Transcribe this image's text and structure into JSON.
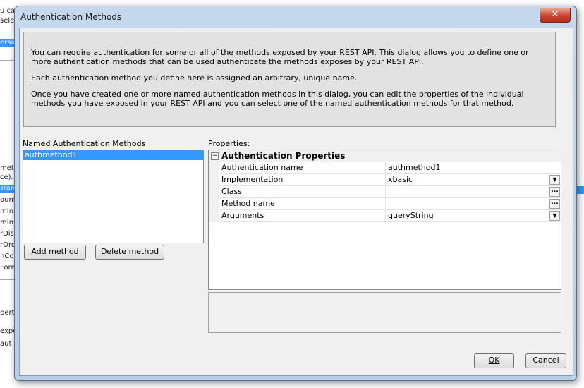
{
  "background": {
    "fragments": [
      "u can",
      "sele",
      "ersion",
      "meth",
      "ce).",
      "Tran",
      "ount",
      "mIns",
      "mIns",
      "rDisp",
      "rOrd",
      "nCom",
      "Form",
      "perti",
      "expo",
      "aut"
    ]
  },
  "dialog": {
    "title": "Authentication Methods",
    "close_glyph": "✕",
    "info": {
      "p1": "You can require authentication for some or all of the methods exposed by your REST API. This dialog allows you to define one or more authentication methods that can be used authenticate the methods exposes by your REST API.",
      "p2": "Each authentication method you define here is assigned an arbitrary, unique name.",
      "p3": "Once you have created one or more named authentication methods in this dialog, you can edit the properties of the individual methods you have exposed in your REST API and you can select one of the named authentication methods for that method."
    },
    "methods_label": "Named Authentication Methods",
    "methods": [
      "authmethod1"
    ],
    "add_button": "Add method",
    "delete_button": "Delete method",
    "properties_label": "Properties:",
    "grid": {
      "category": "Authentication Properties",
      "toggle": "−",
      "rows": [
        {
          "name": "Authentication name",
          "value": "authmethod1"
        },
        {
          "name": "Implementation",
          "value": "xbasic"
        },
        {
          "name": "Class",
          "value": ""
        },
        {
          "name": "Method name",
          "value": ""
        },
        {
          "name": "Arguments",
          "value": "queryString"
        }
      ],
      "dropdown_glyph": "▼",
      "ellipsis_glyph": "..."
    },
    "ok_button": "OK",
    "cancel_button": "Cancel"
  }
}
